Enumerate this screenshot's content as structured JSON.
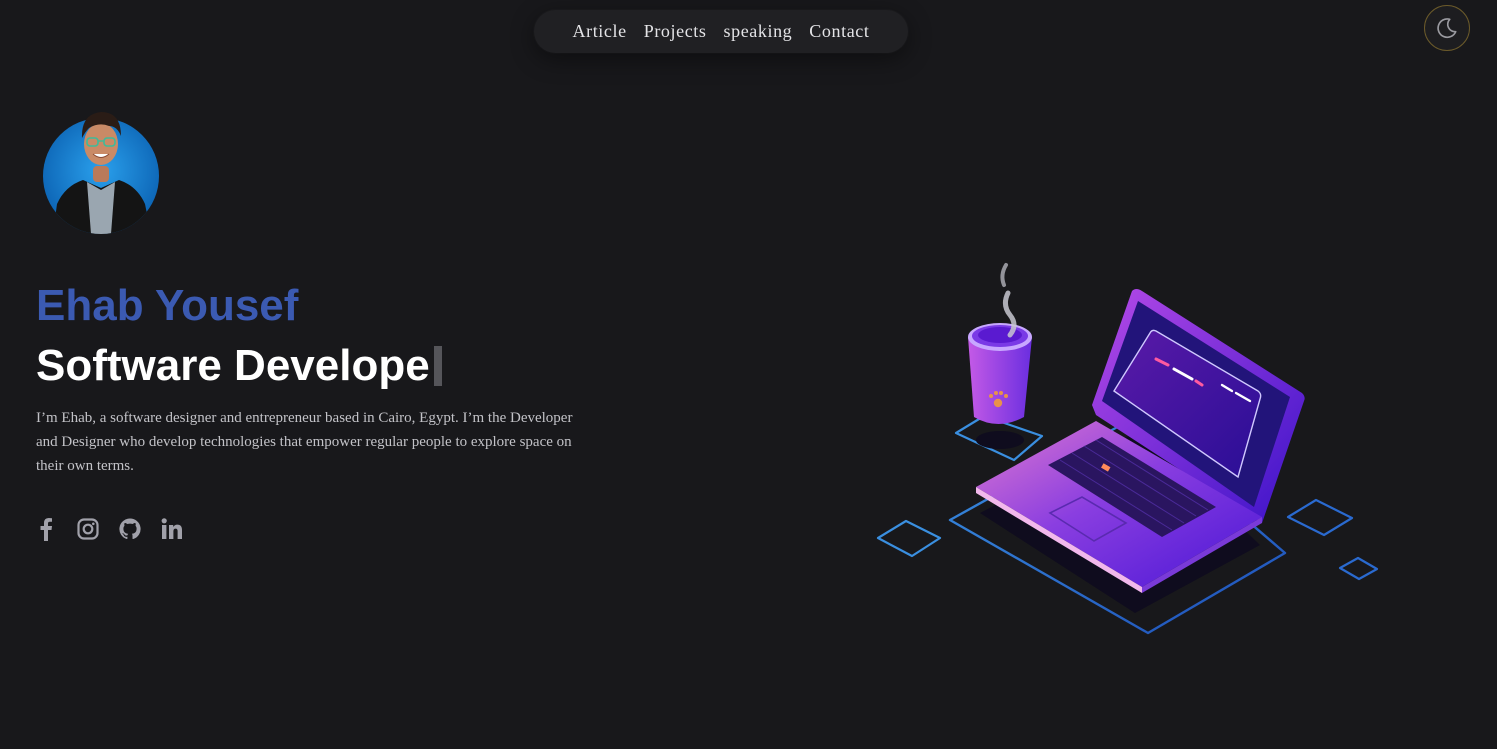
{
  "nav": {
    "items": [
      {
        "label": "Article"
      },
      {
        "label": "Projects"
      },
      {
        "label": "speaking"
      },
      {
        "label": "Contact"
      }
    ]
  },
  "theme_toggle": {
    "icon": "moon-icon"
  },
  "hero": {
    "name": "Ehab Yousef",
    "role_typed": "Software Develope",
    "bio": "I’m Ehab, a software designer and entrepreneur based in Cairo, Egypt. I’m the Developer and Designer who develop technologies that empower regular people to explore space on their own terms."
  },
  "socials": [
    {
      "icon": "facebook-icon"
    },
    {
      "icon": "instagram-icon"
    },
    {
      "icon": "github-icon"
    },
    {
      "icon": "linkedin-icon"
    }
  ],
  "colors": {
    "background": "#18181b",
    "name_accent": "#3b5ab2",
    "toggle_border": "#6b5a2a"
  }
}
